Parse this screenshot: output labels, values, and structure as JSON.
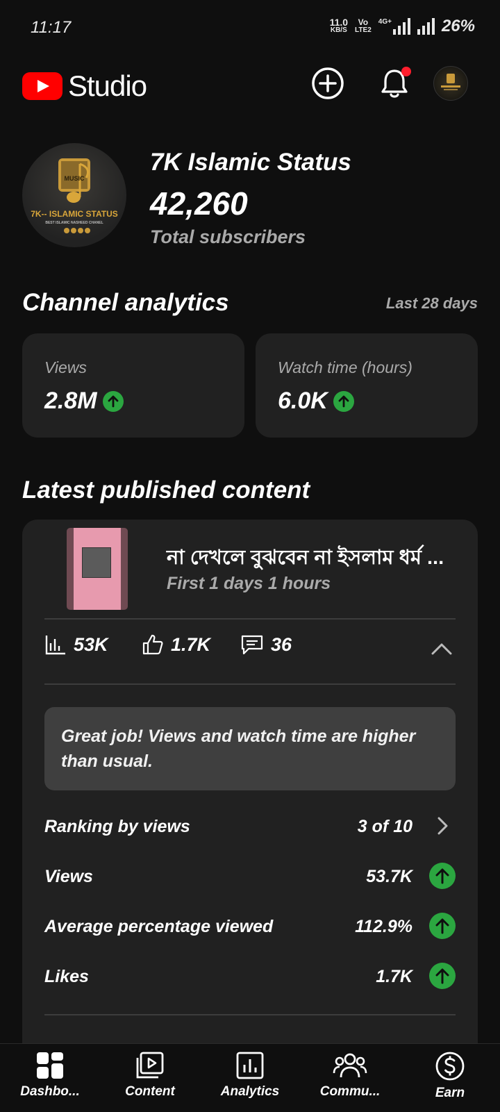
{
  "status_bar": {
    "time": "11:17",
    "speed": "11.0",
    "speed_unit": "KB/S",
    "volte_top": "Vo",
    "volte_bottom": "LTE2",
    "network": "4G+",
    "battery": "26%"
  },
  "header": {
    "app_name": "Studio",
    "icons": [
      "youtube-logo-icon",
      "add-circle-icon",
      "bell-icon",
      "account-avatar"
    ],
    "notification_dot_color": "#ff1e2d"
  },
  "channel": {
    "name": "7K Islamic Status",
    "subscribers": "42,260",
    "subscribers_label": "Total subscribers",
    "avatar_text": {
      "music": "MUSIC",
      "title": "7K-- ISLAMIC STATUS",
      "subtitle": "BEST ISLAMIC NASHEED CHANEL"
    }
  },
  "analytics": {
    "title": "Channel analytics",
    "period": "Last 28 days",
    "cards": [
      {
        "label": "Views",
        "value": "2.8M",
        "trend": "up"
      },
      {
        "label": "Watch time (hours)",
        "value": "6.0K",
        "trend": "up"
      }
    ]
  },
  "latest": {
    "title": "Latest published content",
    "video_title": "না দেখলে বুঝবেন না ইসলাম ধর্ম ...",
    "video_age": "First 1 days 1 hours",
    "stats": {
      "views": "53K",
      "likes": "1.7K",
      "comments": "36"
    },
    "banner": "Great job! Views and watch time are higher than usual.",
    "rows": [
      {
        "label": "Ranking by views",
        "value": "3 of 10",
        "icon": "chevron-right-icon"
      },
      {
        "label": "Views",
        "value": "53.7K",
        "icon": "trend-up-icon"
      },
      {
        "label": "Average percentage viewed",
        "value": "112.9%",
        "icon": "trend-up-icon"
      },
      {
        "label": "Likes",
        "value": "1.7K",
        "icon": "trend-up-icon"
      }
    ]
  },
  "nav": [
    {
      "label": "Dashbo...",
      "icon": "dashboard-icon"
    },
    {
      "label": "Content",
      "icon": "content-icon"
    },
    {
      "label": "Analytics",
      "icon": "analytics-icon"
    },
    {
      "label": "Commu...",
      "icon": "community-icon"
    },
    {
      "label": "Earn",
      "icon": "dollar-icon"
    }
  ],
  "colors": {
    "background": "#0f0f0f",
    "card": "#212121",
    "accent_red": "#ff0000",
    "trend_green": "#2ba640"
  }
}
